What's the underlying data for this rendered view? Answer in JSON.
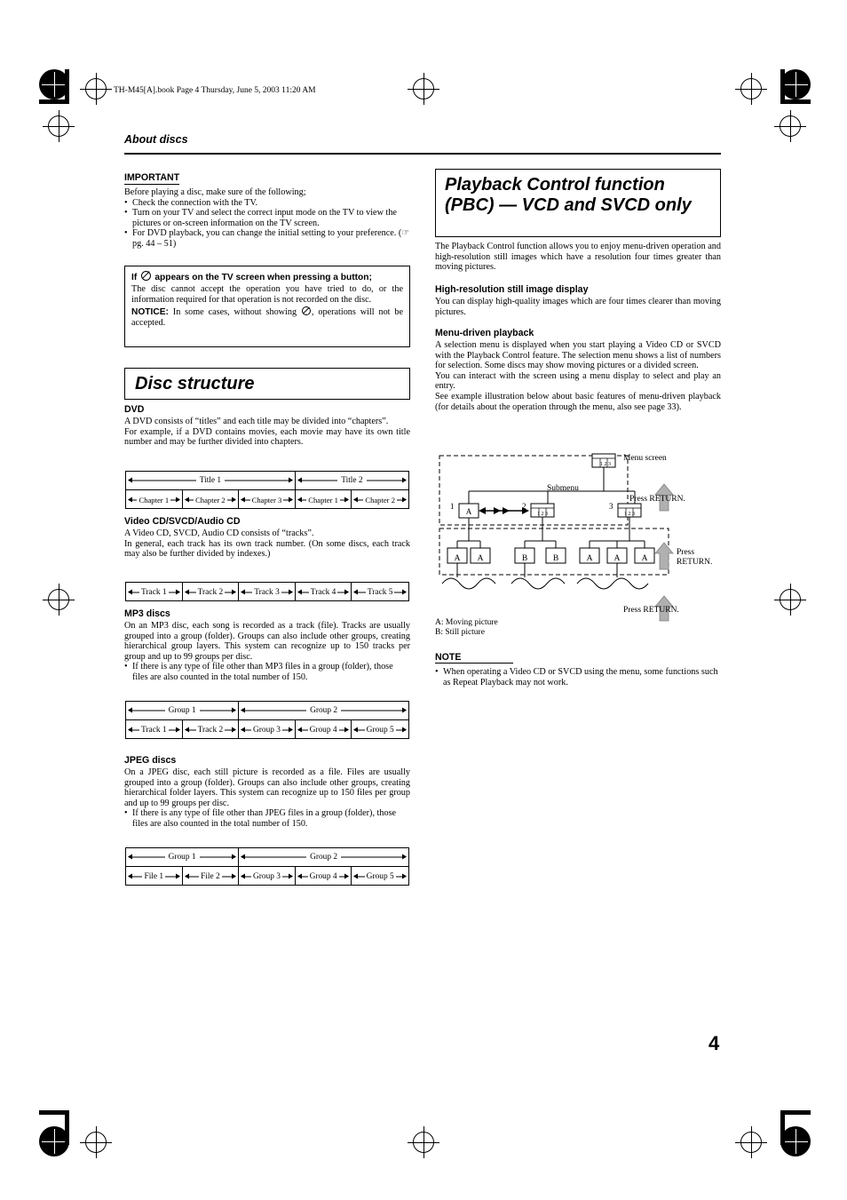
{
  "header": {
    "filename_line": "TH-M45[A].book  Page 4  Thursday, June 5, 2003  11:20 AM"
  },
  "running_head": "About discs",
  "page_number": "4",
  "left_column": {
    "important": {
      "heading": "IMPORTANT",
      "intro": "Before playing a disc, make sure of the following;",
      "bullets": [
        "Check the connection with the TV.",
        "Turn on your TV and select the correct input mode on the TV to view the pictures or on-screen information on the TV screen.",
        "For DVD playback, you can change the initial setting to your preference. (☞ pg. 44 – 51)"
      ]
    },
    "prohibit_box": {
      "title_pre": "If",
      "title_icon": "prohibit-icon",
      "title_post": "appears on the TV screen when pressing a button;",
      "body": "The disc cannot accept the operation you have tried to do, or the information required for that operation is not recorded on the disc.",
      "notice_label": "NOTICE:",
      "notice_text_pre": "In some cases, without showing",
      "notice_text_post": ", operations will not be accepted."
    },
    "disc_structure": {
      "title": "Disc structure",
      "dvd": {
        "heading": "DVD",
        "paragraphs": [
          "A DVD consists of “titles” and each title may be divided into “chapters”.",
          "For example, if a DVD contains movies, each movie may have its own title number and may be further divided into chapters."
        ],
        "table": {
          "row1": [
            "Title 1",
            "Title 2"
          ],
          "row2": [
            "Chapter 1",
            "Chapter 2",
            "Chapter 3",
            "Chapter 1",
            "Chapter 2"
          ]
        }
      },
      "vcd": {
        "heading": "Video CD/SVCD/Audio CD",
        "paragraphs": [
          "A Video CD, SVCD, Audio CD consists of “tracks”.",
          "In general, each track has its own track number. (On some discs, each track may also be further divided by indexes.)"
        ],
        "table": {
          "row1": [
            "Track 1",
            "Track 2",
            "Track 3",
            "Track 4",
            "Track 5"
          ]
        }
      },
      "mp3": {
        "heading": "MP3 discs",
        "paragraphs": [
          "On an MP3 disc, each song is recorded as a track (file). Tracks are usually grouped into a group (folder). Groups can also include other groups, creating hierarchical group layers. This system can recognize up to 150 tracks per group and up to 99 groups per disc."
        ],
        "bullets": [
          "If there is any type of file other than MP3 files in a group (folder), those files are also counted in the total number of 150."
        ],
        "table": {
          "row1": [
            "Group 1",
            "Group 2"
          ],
          "row2": [
            "Track 1",
            "Track 2",
            "Group 3",
            "Group 4",
            "Group 5"
          ]
        }
      },
      "jpeg": {
        "heading": "JPEG discs",
        "paragraphs": [
          "On a JPEG disc, each still picture is recorded as a file. Files are usually grouped into a group (folder). Groups can also include other groups, creating hierarchical folder layers. This system can recognize up to 150 files per group and up to 99 groups per disc."
        ],
        "bullets": [
          "If there is any type of file other than JPEG files in a group (folder), those files are also counted in the total number of 150."
        ],
        "table": {
          "row1": [
            "Group 1",
            "Group 2"
          ],
          "row2": [
            "File 1",
            "File 2",
            "Group 3",
            "Group 4",
            "Group 5"
          ]
        }
      }
    }
  },
  "right_column": {
    "title": "Playback Control function (PBC) — VCD and SVCD only",
    "intro": "The Playback Control function allows you to enjoy menu-driven operation and high-resolution still images which have a resolution four times greater than moving pictures.",
    "sections": [
      {
        "heading": "High-resolution still image display",
        "paragraphs": [
          "You can display high-quality images which are four times clearer than moving pictures."
        ]
      },
      {
        "heading": "Menu-driven playback",
        "paragraphs": [
          "A selection menu is displayed when you start playing a Video CD or SVCD with the Playback Control feature. The selection menu shows a list of numbers for selection. Some discs may show moving pictures or a divided screen.",
          "You can interact with the screen using a menu display to select and play an entry.",
          "See example illustration below about basic features of menu-driven playback (for details about the operation through the menu, also see page 33)."
        ]
      }
    ],
    "diagram": {
      "menu_screen_label": "Menu screen",
      "submenu_label": "Submenu",
      "menu_screen_box": "1 2 3",
      "press_return_1": "Press RETURN.",
      "press_return_2": "Press RETURN.",
      "press_return_3": "Press RETURN.",
      "level2": [
        {
          "num": "1",
          "box": "A"
        },
        {
          "num": "2",
          "box": "1 2 3"
        },
        {
          "num": "3",
          "box": "1 2 3"
        }
      ],
      "level3": [
        "A",
        "A",
        "B",
        "B",
        "A",
        "A",
        "A"
      ],
      "legend": [
        "A: Moving picture",
        "B: Still picture"
      ]
    },
    "note": {
      "heading": "NOTE",
      "bullets": [
        "When operating a Video CD or SVCD using the menu, some functions such as Repeat Playback may not work."
      ]
    }
  }
}
